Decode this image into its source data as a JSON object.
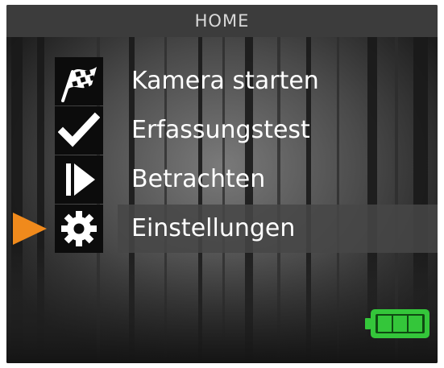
{
  "header": {
    "title": "HOME"
  },
  "menu": {
    "items": [
      {
        "label": "Kamera starten",
        "icon": "checkered-flag-icon",
        "selected": false
      },
      {
        "label": "Erfassungstest",
        "icon": "checkmark-icon",
        "selected": false
      },
      {
        "label": "Betrachten",
        "icon": "play-icon",
        "selected": false
      },
      {
        "label": "Einstellungen",
        "icon": "gear-icon",
        "selected": true
      }
    ]
  },
  "pointer": {
    "icon": "selection-arrow-icon",
    "color": "#f08a1c"
  },
  "battery": {
    "icon": "battery-icon",
    "level_bars": 3,
    "max_bars": 3,
    "color": "#34c63a"
  },
  "colors": {
    "background": "#2b2b2b",
    "header": "#3c3c3c",
    "text": "#ffffff"
  }
}
